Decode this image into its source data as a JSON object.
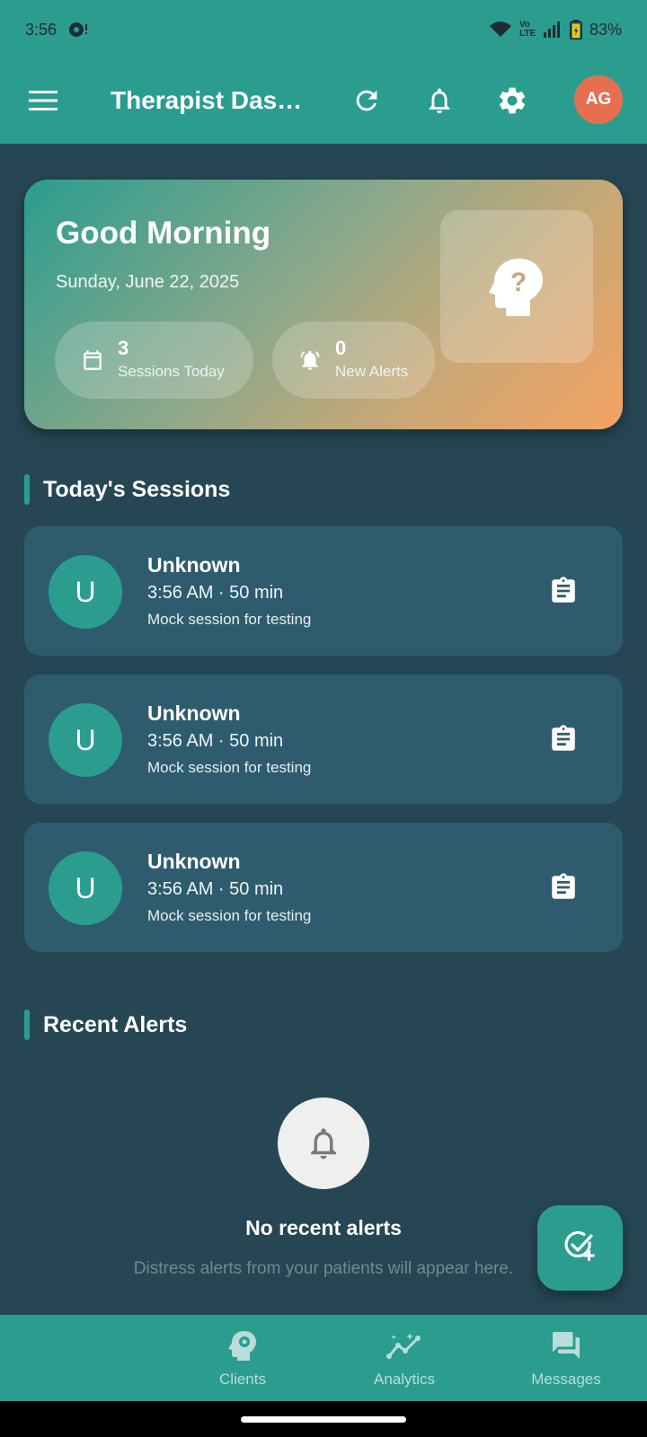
{
  "status_bar": {
    "time": "3:56",
    "battery": "83%",
    "network_label": "Vo LTE"
  },
  "app_bar": {
    "title": "Therapist Das…",
    "avatar_initials": "AG",
    "icons": [
      "menu-icon",
      "refresh-icon",
      "bell-icon",
      "gear-icon"
    ]
  },
  "hero": {
    "greeting": "Good Morning",
    "date": "Sunday, June 22, 2025",
    "stats": [
      {
        "value": "3",
        "label": "Sessions Today",
        "icon": "calendar-icon"
      },
      {
        "value": "0",
        "label": "New Alerts",
        "icon": "alarm-bell-icon"
      }
    ],
    "illustration_icon": "head-question-icon"
  },
  "sessions": {
    "title": "Today's Sessions",
    "items": [
      {
        "initial": "U",
        "name": "Unknown",
        "time": "3:56 AM · 50 min",
        "note": "Mock session for testing"
      },
      {
        "initial": "U",
        "name": "Unknown",
        "time": "3:56 AM · 50 min",
        "note": "Mock session for testing"
      },
      {
        "initial": "U",
        "name": "Unknown",
        "time": "3:56 AM · 50 min",
        "note": "Mock session for testing"
      }
    ]
  },
  "alerts": {
    "title": "Recent Alerts",
    "empty_title": "No recent alerts",
    "empty_subtitle": "Distress alerts from your patients will appear here."
  },
  "fab": {
    "icon": "check-add-icon"
  },
  "bottom_nav": {
    "items": [
      {
        "label": "Clients",
        "icon": "head-gear-icon"
      },
      {
        "label": "Analytics",
        "icon": "analytics-icon"
      },
      {
        "label": "Messages",
        "icon": "messages-icon"
      }
    ]
  },
  "colors": {
    "primary": "#2a9d8f",
    "background": "#264653",
    "card": "#2e5c6e",
    "accent": "#e76f51",
    "warm": "#f4a261"
  }
}
